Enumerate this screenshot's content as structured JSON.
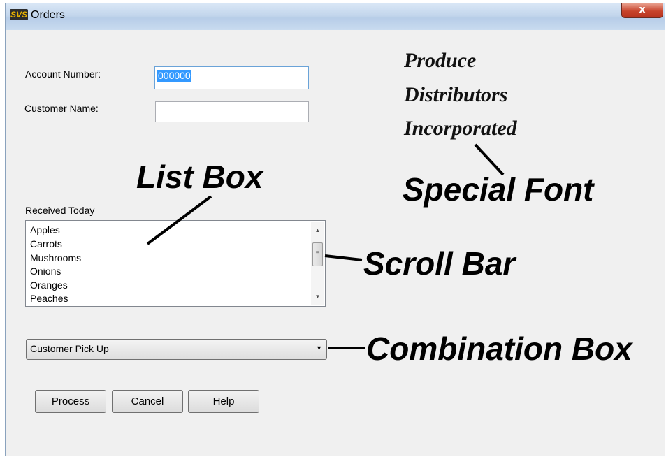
{
  "window": {
    "title": "Orders",
    "icon": "app-icon",
    "close_label": "x"
  },
  "form": {
    "account_label": "Account Number:",
    "account_value": "000000",
    "customer_label": "Customer Name:",
    "customer_value": "",
    "list_label": "Received Today",
    "list_items": [
      "Apples",
      "Carrots",
      "Mushrooms",
      "Onions",
      "Oranges",
      "Peaches"
    ],
    "combo_value": "Customer Pick Up",
    "buttons": {
      "process": "Process",
      "cancel": "Cancel",
      "help": "Help"
    }
  },
  "company_lines": [
    "Produce",
    "Distributors",
    "Incorporated"
  ],
  "annotations": {
    "list_box": "List Box",
    "special_font": "Special Font",
    "scroll_bar": "Scroll Bar",
    "combination_box": "Combination Box"
  },
  "colors": {
    "selection": "#3399ff",
    "close_button": "#c7432b",
    "title_bar": "#c3d6ec"
  }
}
